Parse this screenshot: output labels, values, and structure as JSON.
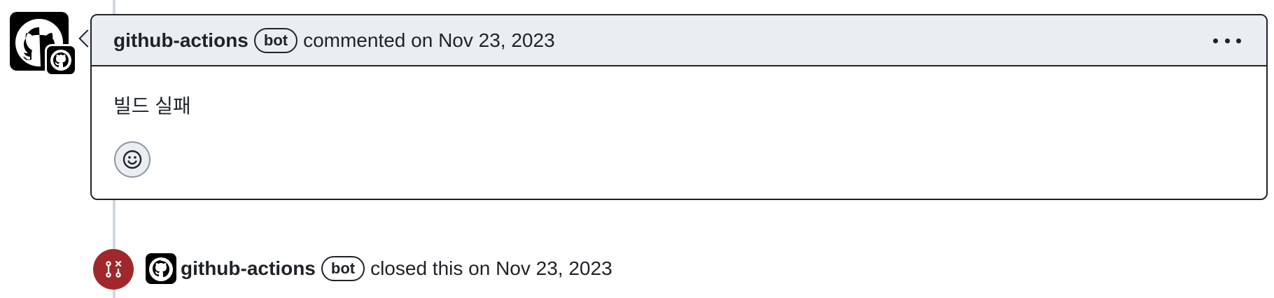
{
  "comment": {
    "author": "github-actions",
    "badge": "bot",
    "meta": "commented on Nov 23, 2023",
    "body": "빌드 실패"
  },
  "event": {
    "author": "github-actions",
    "badge": "bot",
    "action_text": "closed this on Nov 23, 2023"
  },
  "icons": {
    "avatar": "github-octocat-icon",
    "kebab": "kebab-horizontal-icon",
    "reaction": "smiley-icon",
    "closed": "git-pull-request-closed-icon"
  },
  "colors": {
    "header_bg": "#eaeef2",
    "closed_red": "#a0282c",
    "timeline": "#d0d7de"
  }
}
